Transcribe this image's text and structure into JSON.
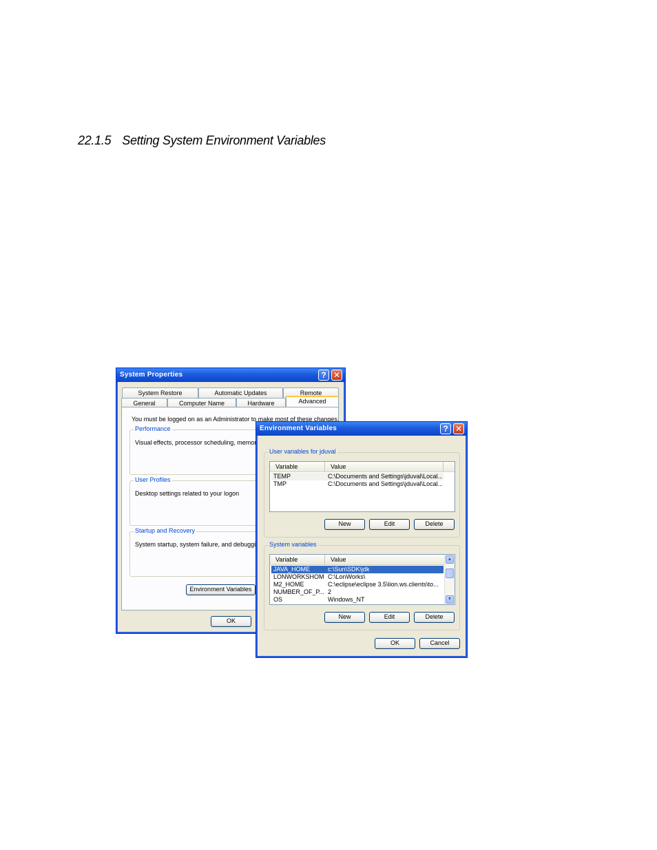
{
  "heading": {
    "number": "22.1.5",
    "title": "Setting System Environment Variables"
  },
  "system_properties": {
    "title": "System Properties",
    "help_glyph": "?",
    "close_glyph": "✕",
    "tabs_row1": [
      "System Restore",
      "Automatic Updates",
      "Remote"
    ],
    "tabs_row2": [
      "General",
      "Computer Name",
      "Hardware",
      "Advanced"
    ],
    "active_tab": "Advanced",
    "admin_notice": "You must be logged on as an Administrator to make most of these changes.",
    "performance": {
      "title": "Performance",
      "text": "Visual effects, processor scheduling, memory u"
    },
    "user_profiles": {
      "title": "User Profiles",
      "text": "Desktop settings related to your logon"
    },
    "startup_recovery": {
      "title": "Startup and Recovery",
      "text": "System startup, system failure, and debugging i"
    },
    "env_button": "Environment Variables",
    "ok_button": "OK"
  },
  "environment_variables": {
    "title": "Environment Variables",
    "help_glyph": "?",
    "close_glyph": "✕",
    "user_group_title": "User variables for jduval",
    "system_group_title": "System variables",
    "columns": [
      "Variable",
      "Value"
    ],
    "user_vars": [
      {
        "name": "TEMP",
        "value": "C:\\Documents and Settings\\jduval\\Local..."
      },
      {
        "name": "TMP",
        "value": "C:\\Documents and Settings\\jduval\\Local..."
      }
    ],
    "system_vars": [
      {
        "name": "JAVA_HOME",
        "value": "c:\\Sun\\SDK\\jdk",
        "selected": true
      },
      {
        "name": "LONWORKSHOME",
        "value": "C:\\LonWorks\\"
      },
      {
        "name": "M2_HOME",
        "value": "C:\\eclipse\\eclipse 3.5\\lion.ws.clients\\to..."
      },
      {
        "name": "NUMBER_OF_P...",
        "value": "2"
      },
      {
        "name": "OS",
        "value": "Windows_NT"
      }
    ],
    "new_button": "New",
    "edit_button": "Edit",
    "delete_button": "Delete",
    "ok_button": "OK",
    "cancel_button": "Cancel"
  }
}
